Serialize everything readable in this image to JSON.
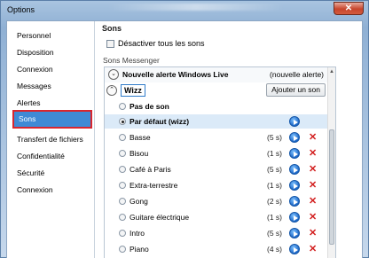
{
  "window": {
    "title": "Options",
    "close_icon": "close-icon"
  },
  "nav": {
    "items": [
      {
        "label": "Personnel"
      },
      {
        "label": "Disposition"
      },
      {
        "label": "Connexion"
      },
      {
        "label": "Messages"
      },
      {
        "label": "Alertes"
      },
      {
        "label": "Sons",
        "active": true
      },
      {
        "label": "Transfert de fichiers"
      },
      {
        "label": "Confidentialité"
      },
      {
        "label": "Sécurité"
      },
      {
        "label": "Connexion"
      }
    ]
  },
  "sounds": {
    "heading": "Sons",
    "disable_all_label": "Désactiver tous les sons",
    "section_label": "Sons Messenger",
    "group_alert": {
      "title": "Nouvelle alerte Windows Live",
      "right": "(nouvelle alerte)"
    },
    "group_wizz": {
      "title": "Wizz",
      "add_button": "Ajouter un son"
    },
    "options": [
      {
        "label": "Pas de son",
        "duration": "",
        "checked": false,
        "bold": true,
        "play": false,
        "delete": false
      },
      {
        "label": "Par défaut (wizz)",
        "duration": "",
        "checked": true,
        "bold": true,
        "play": true,
        "delete": false
      },
      {
        "label": "Basse",
        "duration": "(5 s)",
        "checked": false,
        "bold": false,
        "play": true,
        "delete": true
      },
      {
        "label": "Bisou",
        "duration": "(1 s)",
        "checked": false,
        "bold": false,
        "play": true,
        "delete": true
      },
      {
        "label": "Café à Paris",
        "duration": "(5 s)",
        "checked": false,
        "bold": false,
        "play": true,
        "delete": true
      },
      {
        "label": "Extra-terrestre",
        "duration": "(1 s)",
        "checked": false,
        "bold": false,
        "play": true,
        "delete": true
      },
      {
        "label": "Gong",
        "duration": "(2 s)",
        "checked": false,
        "bold": false,
        "play": true,
        "delete": true
      },
      {
        "label": "Guitare électrique",
        "duration": "(1 s)",
        "checked": false,
        "bold": false,
        "play": true,
        "delete": true
      },
      {
        "label": "Intro",
        "duration": "(5 s)",
        "checked": false,
        "bold": false,
        "play": true,
        "delete": true
      },
      {
        "label": "Piano",
        "duration": "(4 s)",
        "checked": false,
        "bold": false,
        "play": true,
        "delete": true
      }
    ]
  },
  "icons": {
    "play": "play-icon",
    "delete": "delete-x-icon",
    "collapse": "chevron-icon"
  },
  "colors": {
    "accent": "#3f8ad5",
    "highlight_border": "#d8262f",
    "delete": "#d21e1e"
  }
}
